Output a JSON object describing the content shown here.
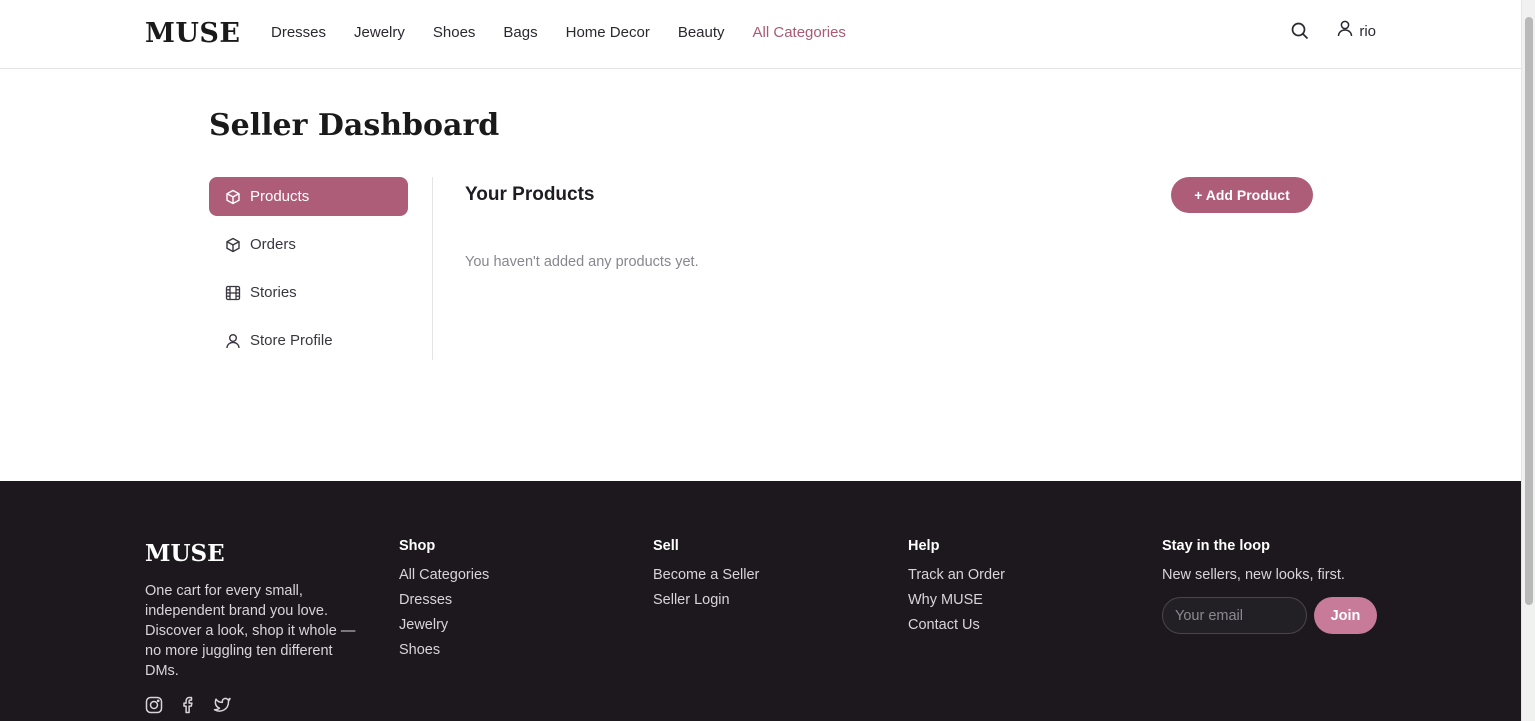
{
  "header": {
    "logo": "MUSE",
    "nav": [
      "Dresses",
      "Jewelry",
      "Shoes",
      "Bags",
      "Home Decor",
      "Beauty",
      "All Categories"
    ],
    "active_nav": "All Categories",
    "user_name": "rio"
  },
  "page": {
    "title": "Seller Dashboard",
    "sidebar": [
      {
        "label": "Products",
        "icon": "box-icon",
        "active": true
      },
      {
        "label": "Orders",
        "icon": "box-icon",
        "active": false
      },
      {
        "label": "Stories",
        "icon": "film-icon",
        "active": false
      },
      {
        "label": "Store Profile",
        "icon": "user-icon",
        "active": false
      }
    ],
    "content_title": "Your Products",
    "add_button": "+ Add Product",
    "empty_message": "You haven't added any products yet."
  },
  "footer": {
    "logo": "MUSE",
    "description": "One cart for every small, independent brand you love. Discover a look, shop it whole — no more juggling ten different DMs.",
    "social": [
      "instagram-icon",
      "facebook-icon",
      "twitter-icon"
    ],
    "shop": {
      "heading": "Shop",
      "links": [
        "All Categories",
        "Dresses",
        "Jewelry",
        "Shoes"
      ]
    },
    "sell": {
      "heading": "Sell",
      "links": [
        "Become a Seller",
        "Seller Login"
      ]
    },
    "help": {
      "heading": "Help",
      "links": [
        "Track an Order",
        "Why MUSE",
        "Contact Us"
      ]
    },
    "newsletter": {
      "heading": "Stay in the loop",
      "subtext": "New sellers, new looks, first.",
      "placeholder": "Your email",
      "button": "Join"
    }
  },
  "colors": {
    "accent": "#ad5d78",
    "footer_bg": "#1c181d",
    "join_button": "#c77b98"
  }
}
